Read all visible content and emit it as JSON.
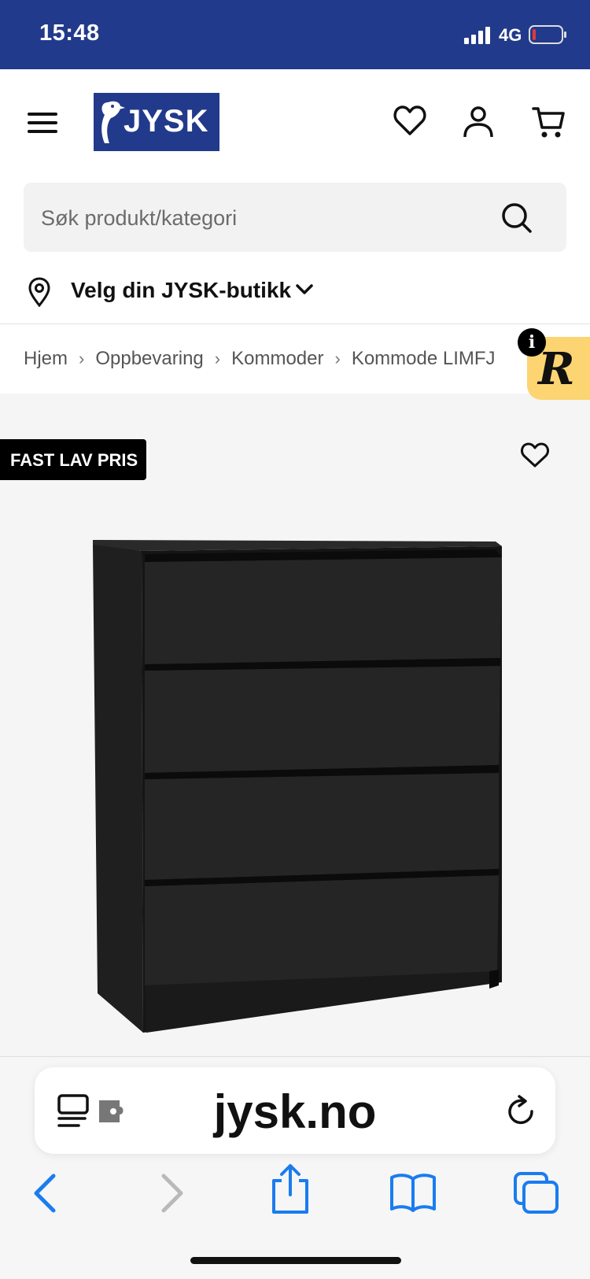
{
  "status_bar": {
    "time": "15:48",
    "network": "4G",
    "battery_color": "#e03a3a"
  },
  "header": {
    "logo_text": "JYSK",
    "brand_color": "#223a8b",
    "search": {
      "placeholder": "Søk produkt/kategori"
    },
    "store_selector": {
      "label": "Velg din JYSK-butikk"
    }
  },
  "breadcrumb": [
    "Hjem",
    "Oppbevaring",
    "Kommoder",
    "Kommode LIMFJ"
  ],
  "product": {
    "badge": "FAST LAV PRIS",
    "image_alt_icon": "dresser-image"
  },
  "widget": {
    "info_label": "i",
    "r_letter": "R",
    "color": "#fcd572"
  },
  "safari": {
    "url": "jysk.no",
    "accent": "#1a7cf0"
  }
}
